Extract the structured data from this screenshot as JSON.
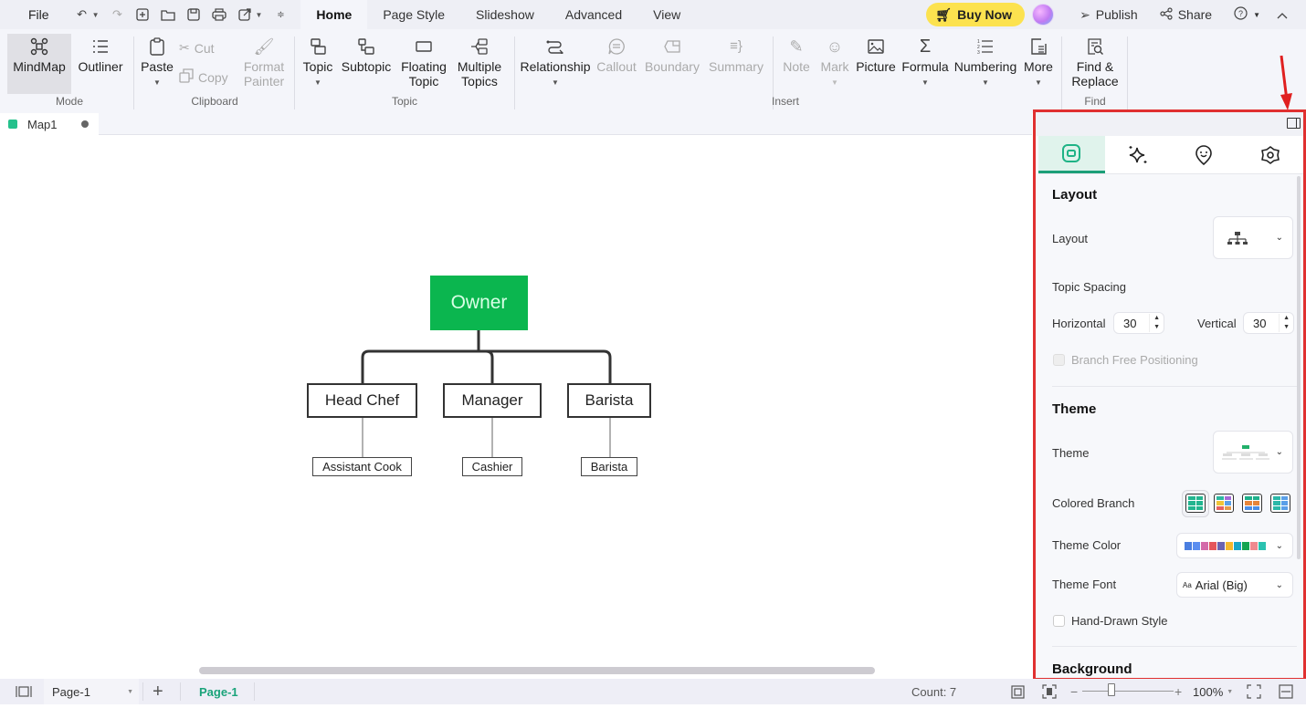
{
  "menubar": {
    "file": "File",
    "quick_access": [
      "undo-icon",
      "redo-icon",
      "new-icon",
      "open-icon",
      "save-icon",
      "print-icon",
      "export-icon",
      "customize-icon"
    ],
    "tabs": [
      "Home",
      "Page Style",
      "Slideshow",
      "Advanced",
      "View"
    ],
    "active_tab": "Home",
    "buy_now": "Buy Now",
    "publish": "Publish",
    "share": "Share"
  },
  "ribbon": {
    "mode": {
      "label": "Mode",
      "mindmap": "MindMap",
      "outliner": "Outliner"
    },
    "clipboard": {
      "label": "Clipboard",
      "paste": "Paste",
      "cut": "Cut",
      "copy": "Copy",
      "format_painter": "Format Painter"
    },
    "topic": {
      "label": "Topic",
      "topic": "Topic",
      "subtopic": "Subtopic",
      "floating_topic": "Floating Topic",
      "multiple_topics": "Multiple Topics"
    },
    "insert": {
      "label": "Insert",
      "relationship": "Relationship",
      "callout": "Callout",
      "boundary": "Boundary",
      "summary": "Summary",
      "note": "Note",
      "mark": "Mark",
      "picture": "Picture",
      "formula": "Formula",
      "numbering": "Numbering",
      "more": "More"
    },
    "find": {
      "label": "Find",
      "find_replace": "Find & Replace"
    }
  },
  "document_tab": {
    "name": "Map1",
    "unsaved": true
  },
  "mindmap": {
    "root": "Owner",
    "root_color": "#0bb64f",
    "children": [
      {
        "label": "Head Chef",
        "children": [
          "Assistant Cook"
        ]
      },
      {
        "label": "Manager",
        "children": [
          "Cashier"
        ]
      },
      {
        "label": "Barista",
        "children": [
          "Barista"
        ]
      }
    ]
  },
  "panel": {
    "tabs": [
      "layout-tab",
      "ai-style-tab",
      "mark-tab",
      "settings-tab"
    ],
    "active_tab": "layout-tab",
    "layout": {
      "title": "Layout",
      "layout_label": "Layout",
      "layout_value": "org-chart-down",
      "topic_spacing": "Topic Spacing",
      "horizontal_label": "Horizontal",
      "horizontal_value": "30",
      "vertical_label": "Vertical",
      "vertical_value": "30",
      "branch_free": "Branch Free Positioning"
    },
    "theme": {
      "title": "Theme",
      "theme_label": "Theme",
      "colored_branch_label": "Colored Branch",
      "colored_branch_options": [
        [
          "#22b58f",
          "#22b58f",
          "#22b58f",
          "#22b58f",
          "#22b58f",
          "#22b58f"
        ],
        [
          "#2db7a0",
          "#a46ad8",
          "#f0c437",
          "#5ba0e6",
          "#e6615f",
          "#e49a4d"
        ],
        [
          "#1fb08b",
          "#1fb08b",
          "#e7853a",
          "#e7853a",
          "#4c8ee6",
          "#4c8ee6"
        ],
        [
          "#2bb8a8",
          "#5a9fe8",
          "#2bb8a8",
          "#5a9fe8",
          "#2bb8a8",
          "#5a9fe8"
        ]
      ],
      "theme_color_label": "Theme Color",
      "theme_colors": [
        "#4a7ee0",
        "#5b8ef0",
        "#d46aa9",
        "#e4565c",
        "#6b63b0",
        "#f5b82e",
        "#19a6c8",
        "#14a552",
        "#f08a8f",
        "#2bc2b0"
      ],
      "theme_font_label": "Theme Font",
      "theme_font_value": "Arial (Big)",
      "hand_drawn": "Hand-Drawn Style"
    },
    "background": {
      "title": "Background"
    }
  },
  "statusbar": {
    "page_select": "Page-1",
    "active_page": "Page-1",
    "count": "Count: 7",
    "zoom": "100%",
    "zoom_fraction": 0.28
  },
  "annotation": {
    "color": "#e02020"
  }
}
